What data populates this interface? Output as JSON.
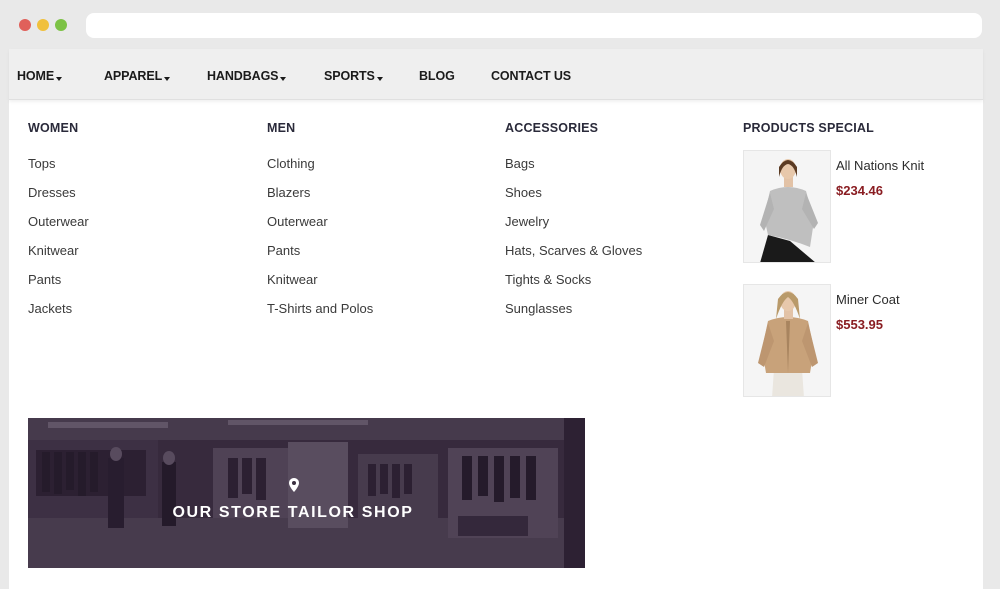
{
  "nav": {
    "items": [
      {
        "label": "HOME",
        "dropdown": true
      },
      {
        "label": "APPAREL",
        "dropdown": true
      },
      {
        "label": "HANDBAGS",
        "dropdown": true
      },
      {
        "label": "SPORTS",
        "dropdown": true
      },
      {
        "label": "BLOG",
        "dropdown": false
      },
      {
        "label": "CONTACT US",
        "dropdown": false
      }
    ]
  },
  "megamenu": {
    "women": {
      "title": "WOMEN",
      "items": [
        "Tops",
        "Dresses",
        "Outerwear",
        "Knitwear",
        "Pants",
        "Jackets"
      ]
    },
    "men": {
      "title": "MEN",
      "items": [
        "Clothing",
        "Blazers",
        "Outerwear",
        "Pants",
        "Knitwear",
        "T-Shirts and Polos"
      ]
    },
    "accessories": {
      "title": "ACCESSORIES",
      "items": [
        "Bags",
        "Shoes",
        "Jewelry",
        "Hats, Scarves & Gloves",
        "Tights & Socks",
        "Sunglasses"
      ]
    },
    "special": {
      "title": "PRODUCTS SPECIAL",
      "products": [
        {
          "name": "All Nations Knit",
          "price": "$234.46"
        },
        {
          "name": "Miner Coat",
          "price": "$553.95"
        }
      ]
    }
  },
  "banner": {
    "title": "OUR STORE TAILOR SHOP",
    "icon": "location-pin-icon"
  },
  "colors": {
    "price": "#8a1d22",
    "banner_tint": "#3b3040"
  }
}
